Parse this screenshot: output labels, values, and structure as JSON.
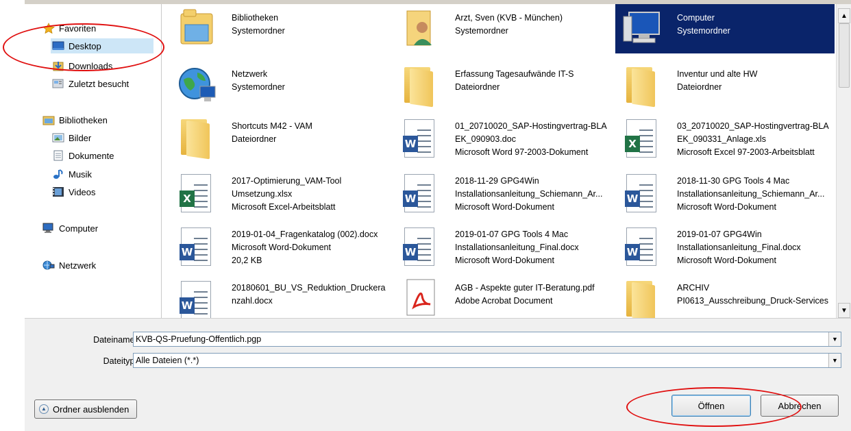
{
  "nav": {
    "items": [
      {
        "label": "Favoriten",
        "icon": "star-icon"
      },
      {
        "label": "Desktop",
        "icon": "desktop-icon"
      },
      {
        "label": "Downloads",
        "icon": "downloads-icon"
      },
      {
        "label": "Zuletzt besucht",
        "icon": "recent-places-icon"
      },
      {
        "label": "Bibliotheken",
        "icon": "libraries-icon"
      },
      {
        "label": "Bilder",
        "icon": "pictures-icon"
      },
      {
        "label": "Dokumente",
        "icon": "documents-icon"
      },
      {
        "label": "Musik",
        "icon": "music-icon"
      },
      {
        "label": "Videos",
        "icon": "videos-icon"
      },
      {
        "label": "Computer",
        "icon": "computer-icon"
      },
      {
        "label": "Netzwerk",
        "icon": "network-icon"
      }
    ]
  },
  "files": [
    {
      "name": "Bibliotheken",
      "line2": "Systemordner",
      "line3": "",
      "icon": "libraries-folder-icon"
    },
    {
      "name": "Arzt, Sven (KVB - München)",
      "line2": "Systemordner",
      "line3": "",
      "icon": "user-folder-icon"
    },
    {
      "name": "Computer",
      "line2": "Systemordner",
      "line3": "",
      "icon": "computer-icon"
    },
    {
      "name": "Netzwerk",
      "line2": "Systemordner",
      "line3": "",
      "icon": "network-globe-icon"
    },
    {
      "name": "Erfassung Tagesaufwände IT-S",
      "line2": "Dateiordner",
      "line3": "",
      "icon": "folder-icon"
    },
    {
      "name": "Inventur und alte HW",
      "line2": "Dateiordner",
      "line3": "",
      "icon": "folder-icon"
    },
    {
      "name": "Shortcuts M42 - VAM",
      "line2": "Dateiordner",
      "line3": "",
      "icon": "folder-icon"
    },
    {
      "name": "01_20710020_SAP-Hostingvertrag-BLA",
      "line2": "EK_090903.doc",
      "line3": "Microsoft Word 97-2003-Dokument",
      "icon": "word-doc-icon"
    },
    {
      "name": "03_20710020_SAP-Hostingvertrag-BLA",
      "line2": "EK_090331_Anlage.xls",
      "line3": "Microsoft Excel 97-2003-Arbeitsblatt",
      "icon": "excel-doc-icon"
    },
    {
      "name": "2017-Optimierung_VAM-Tool",
      "line2": "Umsetzung.xlsx",
      "line3": "Microsoft Excel-Arbeitsblatt",
      "icon": "excel-doc-icon"
    },
    {
      "name": "2018-11-29 GPG4Win",
      "line2": "Installationsanleitung_Schiemann_Ar...",
      "line3": "Microsoft Word-Dokument",
      "icon": "word-doc-icon"
    },
    {
      "name": "2018-11-30 GPG Tools 4 Mac",
      "line2": "Installationsanleitung_Schiemann_Ar...",
      "line3": "Microsoft Word-Dokument",
      "icon": "word-doc-icon"
    },
    {
      "name": "2019-01-04_Fragenkatalog (002).docx",
      "line2": "Microsoft Word-Dokument",
      "line3": "20,2 KB",
      "icon": "word-doc-icon"
    },
    {
      "name": "2019-01-07 GPG Tools 4 Mac",
      "line2": "Installationsanleitung_Final.docx",
      "line3": "Microsoft Word-Dokument",
      "icon": "word-doc-icon"
    },
    {
      "name": "2019-01-07 GPG4Win",
      "line2": "Installationsanleitung_Final.docx",
      "line3": "Microsoft Word-Dokument",
      "icon": "word-doc-icon"
    },
    {
      "name": "20180601_BU_VS_Reduktion_Druckera",
      "line2": "nzahl.docx",
      "line3": "",
      "icon": "word-doc-icon"
    },
    {
      "name": "AGB - Aspekte guter IT-Beratung.pdf",
      "line2": "Adobe Acrobat Document",
      "line3": "",
      "icon": "pdf-doc-icon"
    },
    {
      "name": "ARCHIV",
      "line2": "PI0613_Ausschreibung_Druck-Services",
      "line3": "",
      "icon": "folder-icon"
    }
  ],
  "footer": {
    "filename_label": "Dateiname:",
    "filename_value": "KVB-QS-Pruefung-Offentlich.pgp",
    "filetype_label": "Dateityp:",
    "filetype_value": "Alle Dateien (*.*)",
    "hide_folders_label": "Ordner ausblenden",
    "open_label": "Öffnen",
    "cancel_label": "Abbrechen"
  },
  "colors": {
    "selection": "#0a246a",
    "nav_selection": "#cde6f7",
    "annotation": "#e01010"
  }
}
